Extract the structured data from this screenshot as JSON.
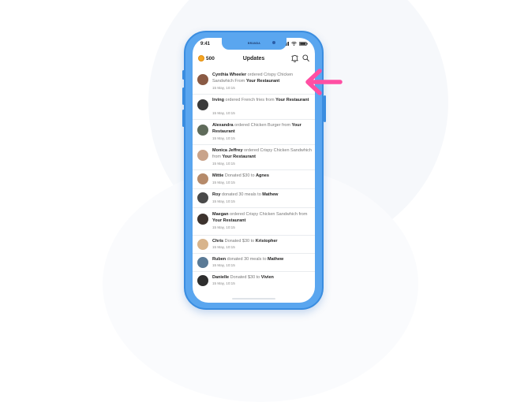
{
  "status_bar": {
    "time": "9:41"
  },
  "notch": {
    "label": "BRANDA"
  },
  "header": {
    "coin_count": "500",
    "title": "Updates"
  },
  "updates": [
    {
      "name": "Cynthia Wheeler",
      "action": "ordered Crispy Chicken Sandwhich From",
      "target": "Your Restaurant",
      "date": "15 May, 10:15",
      "avatar_color": "#8a5a44"
    },
    {
      "name": "Irving",
      "action": "ordered French fries from",
      "target": "Your Restaurant",
      "date": "15 May, 10:15",
      "avatar_color": "#3a3a3a"
    },
    {
      "name": "Alexandra",
      "action": "ordered Chicken Burger from",
      "target": "Your Restaurant",
      "date": "15 May, 10:15",
      "avatar_color": "#5f6b5a"
    },
    {
      "name": "Monica Jeffrey",
      "action": "ordered Crispy Chicken Sandwhich from",
      "target": "Your Restaurant",
      "date": "15 May, 10:15",
      "avatar_color": "#c9a38a"
    },
    {
      "name": "Mittie",
      "action": "Donated $30 to",
      "target": "Agnes",
      "date": "15 May, 10:15",
      "avatar_color": "#b58a6a"
    },
    {
      "name": "Roy",
      "action": "donated 30 meals to",
      "target": "Mathew",
      "date": "15 May, 10:15",
      "avatar_color": "#4a4a4a"
    },
    {
      "name": "Maegan",
      "action": "ordered Crispy Chicken Sandwhich from",
      "target": "Your Restaurant",
      "date": "15 May, 10:15",
      "avatar_color": "#3d332e"
    },
    {
      "name": "Chris",
      "action": "Donated $30 to",
      "target": "Kristopher",
      "date": "15 May, 10:15",
      "avatar_color": "#d8b48c"
    },
    {
      "name": "Ruben",
      "action": "donated 30 meals to",
      "target": "Mathew",
      "date": "15 May, 10:15",
      "avatar_color": "#5a7a96"
    },
    {
      "name": "Danielle",
      "action": "Donated $30 to",
      "target": "Vivien",
      "date": "15 May, 10:15",
      "avatar_color": "#2e2e2e"
    }
  ],
  "colors": {
    "phone_body": "#5aa6ef",
    "arrow": "#ff4fa3",
    "coin": "#f5a623"
  },
  "icons": [
    "signal-icon",
    "wifi-icon",
    "battery-icon",
    "coin-icon",
    "bell-icon",
    "search-icon",
    "pointer-arrow-icon"
  ]
}
